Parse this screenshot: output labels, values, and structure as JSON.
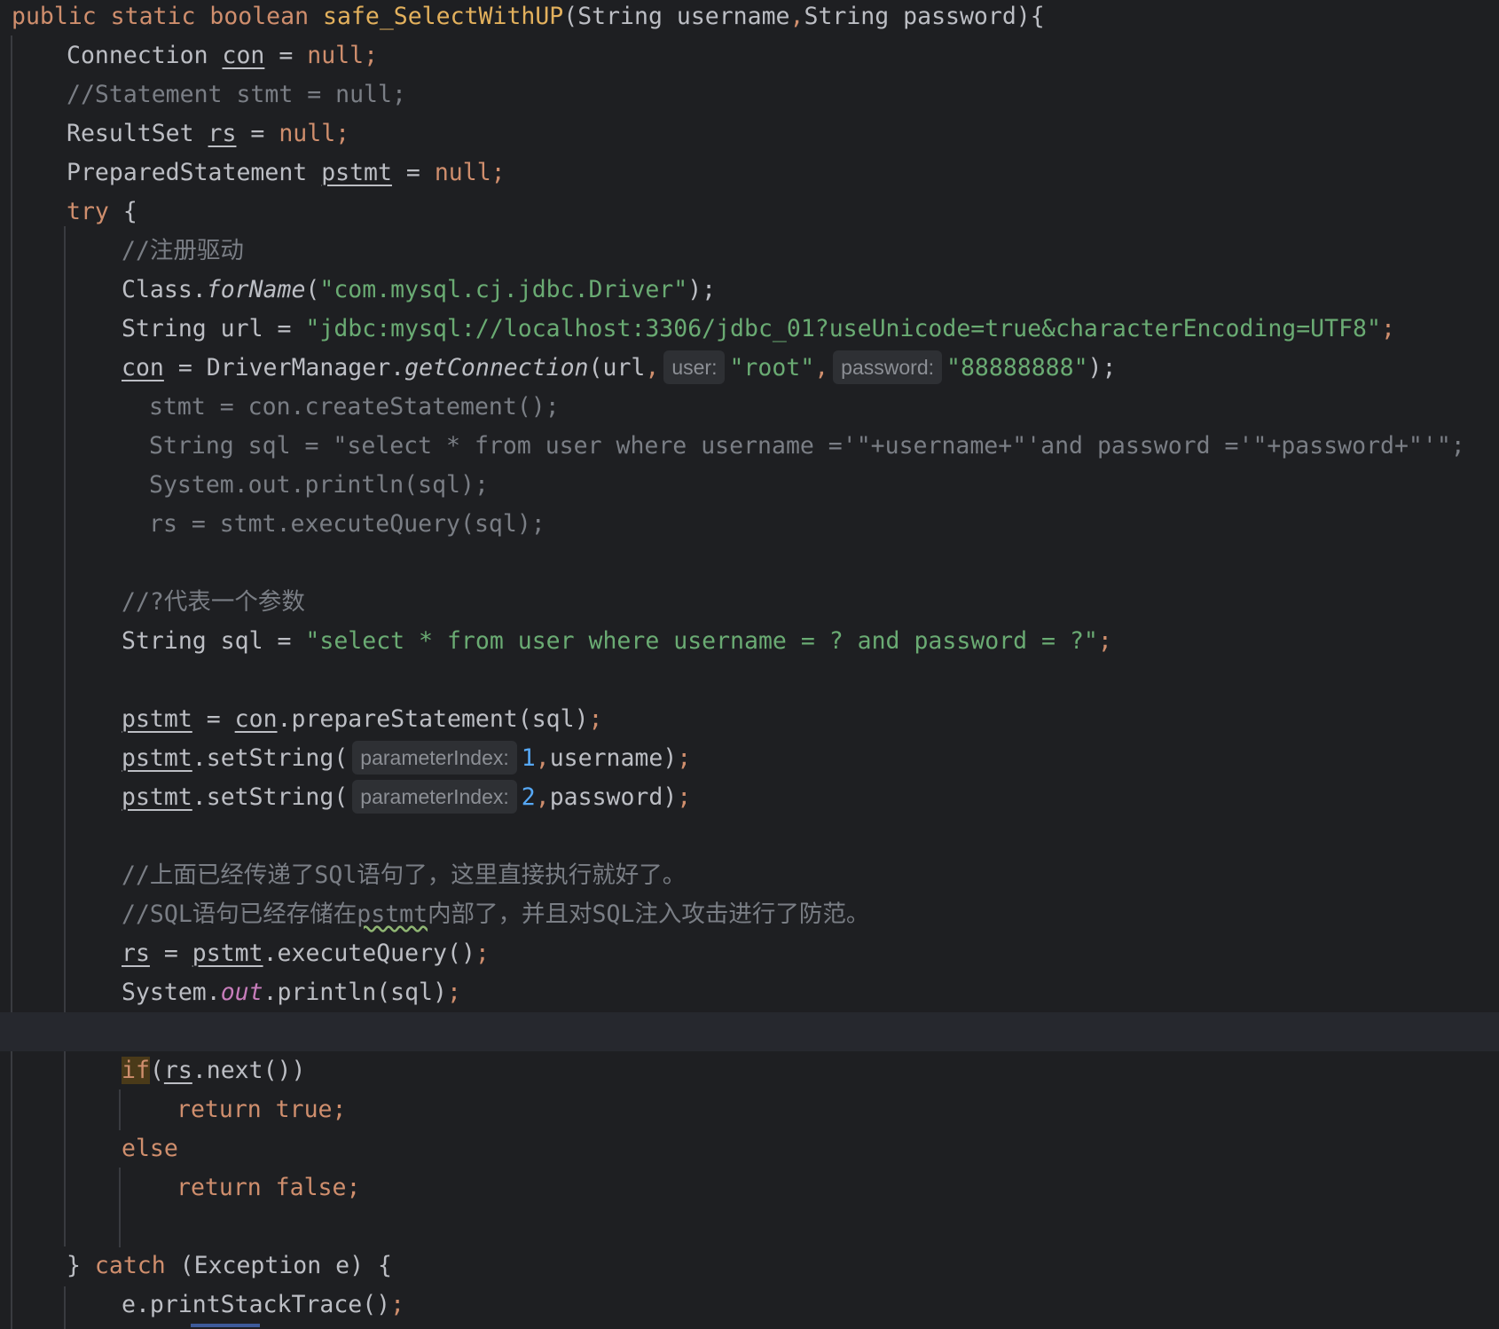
{
  "editor": {
    "language": "Java",
    "theme": "dark",
    "lines": {
      "l01": {
        "a": "public static boolean ",
        "b": "safe_SelectWithUP",
        "c": "(String username",
        "d": ",",
        "e": "String password){"
      },
      "l02": {
        "a": "Connection ",
        "b": "con",
        "c": " = ",
        "d": "null;"
      },
      "l03": {
        "a": "//Statement stmt = null;"
      },
      "l04": {
        "a": "ResultSet ",
        "b": "rs",
        "c": " = ",
        "d": "null;"
      },
      "l05": {
        "a": "PreparedStatement ",
        "b": "pstmt",
        "c": " = ",
        "d": "null;"
      },
      "l06": {
        "a": "try",
        "b": " {"
      },
      "l07": {
        "a": "//注册驱动"
      },
      "l08": {
        "a": "Class.",
        "b": "forName",
        "c": "(",
        "d": "\"com.mysql.cj.jdbc.Driver\"",
        "e": ");"
      },
      "l09": {
        "a": "String url = ",
        "b": "\"jdbc:mysql://localhost:3306/jdbc_01?useUnicode=true&characterEncoding=UTF8\"",
        "c": ";"
      },
      "l10": {
        "a": "con",
        "b": " = DriverManager.",
        "c": "getConnection",
        "d": "(url",
        "e": ",",
        "hint1": "user:",
        "f": "\"root\"",
        "g": ",",
        "hint2": "password:",
        "h": "\"88888888\"",
        "i": ");"
      },
      "l11": {
        "a": "stmt = con.createStatement();"
      },
      "l12": {
        "a": "String sql = \"select * from user where username ='\"+username+\"'and password ='\"+password+\"'\";"
      },
      "l13": {
        "a": "System.out.println(sql);"
      },
      "l14": {
        "a": "rs = stmt.executeQuery(sql);"
      },
      "l15": {
        "a": "//?代表一个参数"
      },
      "l16": {
        "a": "String sql = ",
        "b": "\"select * from user where username = ? and password = ?\"",
        "c": ";"
      },
      "l17": {
        "a": "pstmt",
        "b": " = ",
        "c": "con",
        "d": ".prepareStatement(sql)",
        "e": ";"
      },
      "l18": {
        "a": "pstmt",
        "b": ".setString(",
        "hint": "parameterIndex:",
        "c": "1",
        "d": ",",
        "e": "username)",
        "f": ";"
      },
      "l19": {
        "a": "pstmt",
        "b": ".setString(",
        "hint": "parameterIndex:",
        "c": "2",
        "d": ",",
        "e": "password)",
        "f": ";"
      },
      "l20": {
        "a": "//上面已经传递了SQl语句了，这里直接执行就好了。"
      },
      "l21": {
        "a": "//SQL语句已经存储在",
        "b": "pstmt",
        "c": "内部了，并且对SQL注入攻击进行了防范。"
      },
      "l22": {
        "a": "rs",
        "b": " = ",
        "c": "pstmt",
        "d": ".executeQuery()",
        "e": ";"
      },
      "l23": {
        "a": "System.",
        "b": "out",
        "c": ".println(sql)",
        "d": ";"
      },
      "l24": {
        "a": ""
      },
      "l25": {
        "a": "if",
        "b": "(",
        "c": "rs",
        "d": ".next())"
      },
      "l26": {
        "a": "return true;"
      },
      "l27": {
        "a": "else"
      },
      "l28": {
        "a": "return false;"
      },
      "l29": {
        "a": "} ",
        "b": "catch",
        "c": " (Exception e) {"
      },
      "l30": {
        "a": "e.printStackTrace()",
        "b": ";"
      }
    }
  }
}
